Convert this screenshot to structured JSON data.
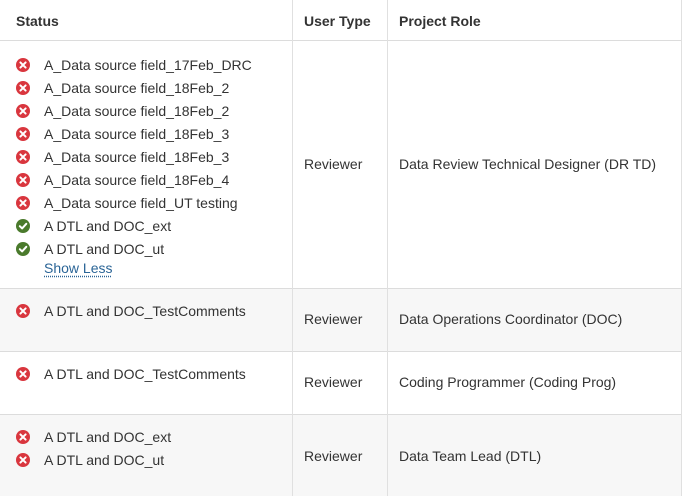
{
  "headers": {
    "status": "Status",
    "user_type": "User Type",
    "project_role": "Project Role"
  },
  "rows": [
    {
      "statuses": [
        {
          "label": "A_Data source field_17Feb_DRC",
          "state": "error"
        },
        {
          "label": "A_Data source field_18Feb_2",
          "state": "error"
        },
        {
          "label": "A_Data source field_18Feb_2",
          "state": "error"
        },
        {
          "label": "A_Data source field_18Feb_3",
          "state": "error"
        },
        {
          "label": "A_Data source field_18Feb_3",
          "state": "error"
        },
        {
          "label": "A_Data source field_18Feb_4",
          "state": "error"
        },
        {
          "label": "A_Data source field_UT testing",
          "state": "error"
        },
        {
          "label": "A DTL and DOC_ext",
          "state": "success"
        },
        {
          "label": "A DTL and DOC_ut",
          "state": "success"
        }
      ],
      "show_less": "Show Less",
      "user_type": "Reviewer",
      "project_role": "Data Review Technical Designer (DR TD)"
    },
    {
      "statuses": [
        {
          "label": "A DTL and DOC_TestComments",
          "state": "error"
        }
      ],
      "user_type": "Reviewer",
      "project_role": "Data Operations Coordinator (DOC)"
    },
    {
      "statuses": [
        {
          "label": "A DTL and DOC_TestComments",
          "state": "error"
        }
      ],
      "user_type": "Reviewer",
      "project_role": "Coding Programmer (Coding Prog)"
    },
    {
      "statuses": [
        {
          "label": "A DTL and DOC_ext",
          "state": "error"
        },
        {
          "label": "A DTL and DOC_ut",
          "state": "error"
        }
      ],
      "user_type": "Reviewer",
      "project_role": "Data Team Lead (DTL)"
    }
  ],
  "colors": {
    "error": "#d9363e",
    "success": "#4a7a2c",
    "link": "#2a6496"
  },
  "icons": {
    "error": "x-circle-icon",
    "success": "check-circle-icon"
  }
}
